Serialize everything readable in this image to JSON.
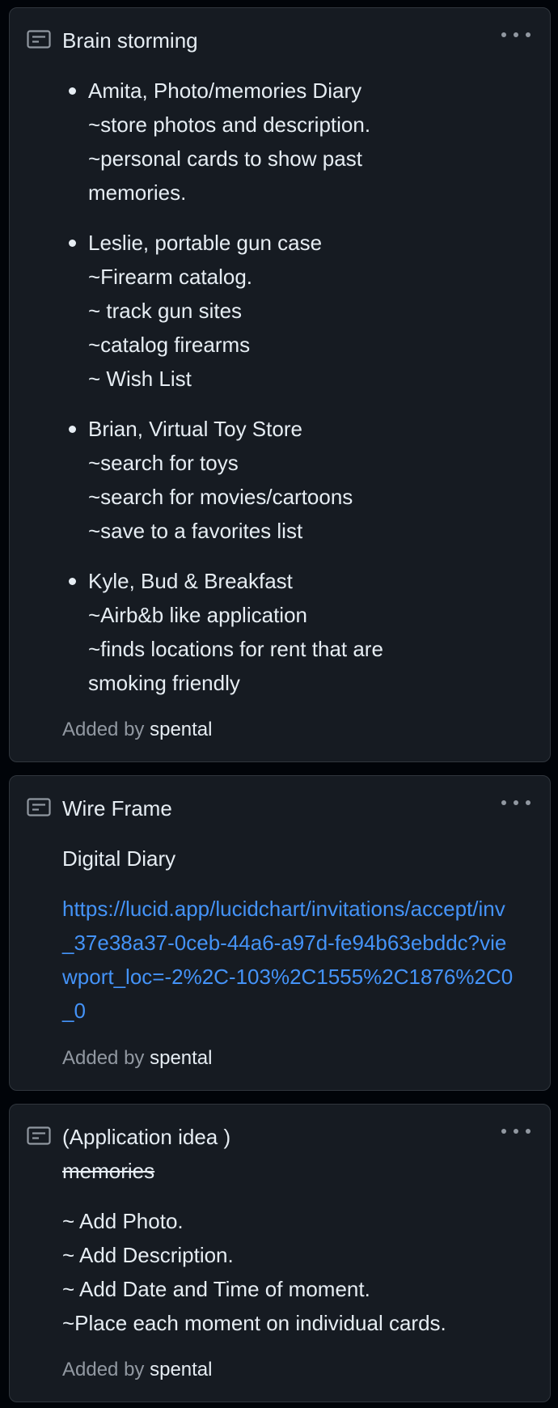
{
  "cards": [
    {
      "title": "Brain storming",
      "items": [
        {
          "lines": [
            "Amita, Photo/memories Diary",
            "~store photos and description.",
            "~personal cards to show past",
            "memories."
          ]
        },
        {
          "lines": [
            "Leslie, portable gun case",
            "~Firearm catalog.",
            "~ track gun sites",
            "~catalog firearms",
            "~ Wish List"
          ]
        },
        {
          "lines": [
            "Brian, Virtual Toy Store",
            "~search for toys",
            "~search for movies/cartoons",
            "~save to a favorites list"
          ]
        },
        {
          "lines": [
            "Kyle, Bud & Breakfast",
            "~Airb&b like application",
            "~finds locations for rent that are",
            "smoking friendly"
          ]
        }
      ],
      "added_by_label": "Added by",
      "added_by_user": "spental"
    },
    {
      "title": "Wire Frame",
      "text": "Digital Diary",
      "link": "https://lucid.app/lucidchart/invitations/accept/inv_37e38a37-0ceb-44a6-a97d-fe94b63ebddc?viewport_loc=-2%2C-103%2C1555%2C1876%2C0_0",
      "added_by_label": "Added by",
      "added_by_user": "spental"
    },
    {
      "title": "(Application idea )",
      "struck_text": "memories",
      "lines": [
        "~ Add Photo.",
        "~ Add Description.",
        "~ Add Date and Time of moment.",
        "~Place each moment on individual cards."
      ],
      "added_by_label": "Added by",
      "added_by_user": "spental"
    }
  ],
  "icons": {
    "note": "note-icon",
    "menu": "kebab-horizontal-icon"
  },
  "colors": {
    "page_bg": "#010409",
    "card_bg": "#161b22",
    "border": "#30363d",
    "text": "#e6edf3",
    "muted": "#9198a1",
    "link": "#4493f8"
  }
}
